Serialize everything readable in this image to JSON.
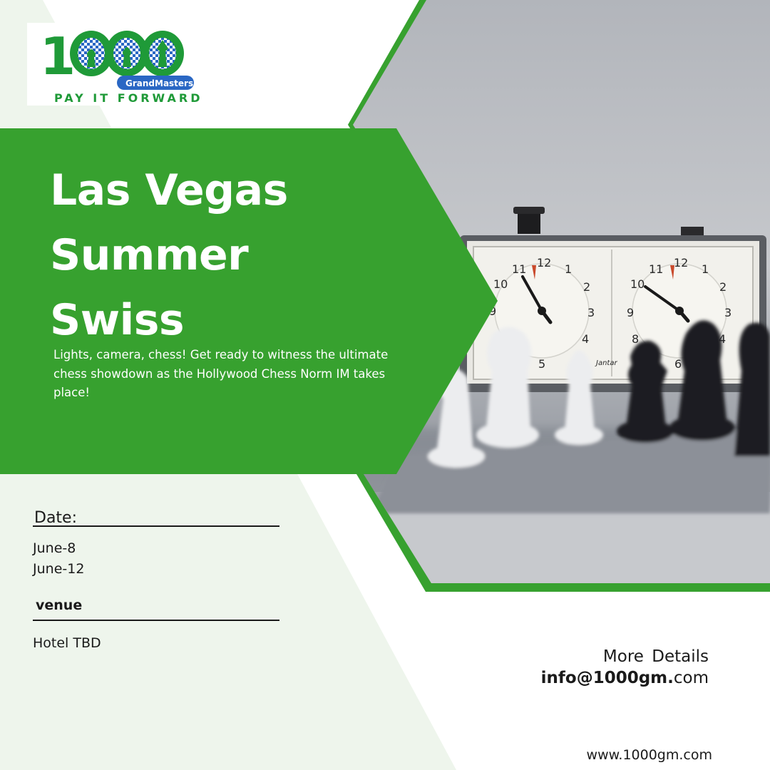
{
  "logo": {
    "digit": "1",
    "tag": "GrandMasters",
    "slogan": "PAY IT FORWARD"
  },
  "headline": {
    "lines": [
      "Las Vegas",
      "Summer",
      "Swiss"
    ]
  },
  "intro": "Lights, camera, chess!  Get ready to witness the ultimate chess showdown as the Hollywood Chess Norm IM takes place!",
  "details": {
    "date_label": "Date:",
    "dates": [
      "June-8",
      "June-12"
    ],
    "venue_label": "venue",
    "venue": "Hotel TBD"
  },
  "contact": {
    "more": "More  Details",
    "email_bold": "info@1000gm.",
    "email_rest": "com",
    "website": "www.1000gm.com"
  },
  "clock": {
    "numerals": [
      "12",
      "1",
      "2",
      "3",
      "4",
      "5",
      "6",
      "8",
      "9",
      "10",
      "11"
    ],
    "maker": "Jantar"
  },
  "colors": {
    "brand_green": "#37a12f",
    "logo_green": "#1f9a38",
    "logo_blue": "#2a67c4",
    "tint": "#eef5ec",
    "text": "#1a1a1a"
  }
}
